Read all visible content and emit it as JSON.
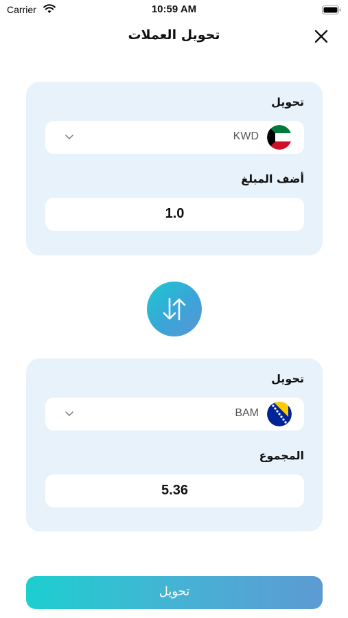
{
  "status_bar": {
    "carrier": "Carrier",
    "time": "10:59 AM"
  },
  "header": {
    "title": "تحويل العملات",
    "close_icon": "close-icon"
  },
  "from_card": {
    "label": "تحويل",
    "currency": "KWD",
    "flag": "kuwait-flag",
    "amount_label": "أضف المبلغ",
    "amount": "1.0"
  },
  "swap": {
    "icon": "swap-arrows-icon",
    "colors": [
      "#1cc8cf",
      "#5b95d3"
    ]
  },
  "to_card": {
    "label": "تحويل",
    "currency": "BAM",
    "flag": "bosnia-flag",
    "total_label": "المجموع",
    "total": "5.36"
  },
  "convert_button": {
    "label": "تحويل"
  },
  "colors": {
    "card_bg": "#e7f2fa",
    "accent_start": "#1ccfcf",
    "accent_end": "#5d9ad3"
  }
}
